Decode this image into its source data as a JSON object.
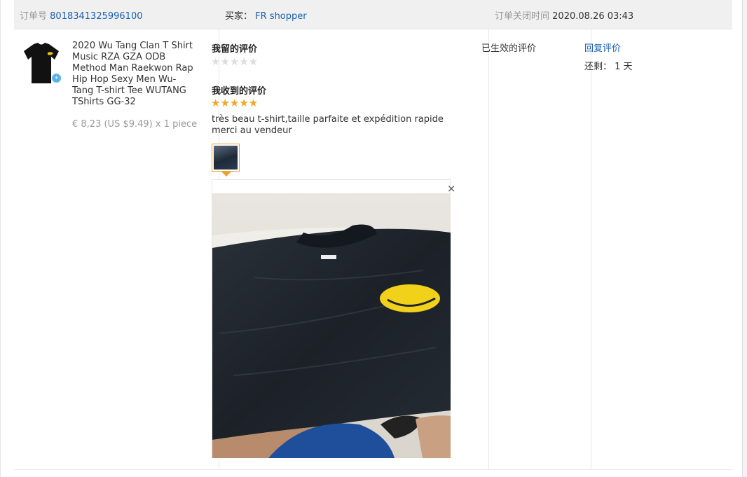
{
  "header": {
    "order_label": "订单号",
    "order_number": "8018341325996100",
    "buyer_label": "买家：",
    "buyer_name": "FR shopper",
    "closed_label": "订单关闭时间",
    "closed_time": "2020.08.26 03:43"
  },
  "product": {
    "title": "2020 Wu Tang Clan T Shirt Music RZA GZA ODB Method Man Raekwon Rap Hip Hop Sexy Men Wu-Tang T-shirt Tee WUTANG TShirts GG-32",
    "price": "€ 8,23 (US $9.49) x 1 piece",
    "thumb_icon": "tshirt-thumbnail"
  },
  "feedback": {
    "my_heading": "我留的评价",
    "my_stars": "★★★★★",
    "received_heading": "我收到的评价",
    "received_stars": "★★★★★",
    "received_rating": 5,
    "review_text": "très beau t-shirt,taille parfaite et expédition rapide merci au vendeur",
    "close_symbol": "×"
  },
  "status": {
    "text": "已生效的评价"
  },
  "actions": {
    "reply_label": "回复评价",
    "remaining_text": "还剩： 1 天"
  },
  "colors": {
    "link": "#1a5fb4",
    "star_filled": "#f5a623",
    "star_empty": "#dddddd",
    "header_bg": "#f0f0f0"
  }
}
